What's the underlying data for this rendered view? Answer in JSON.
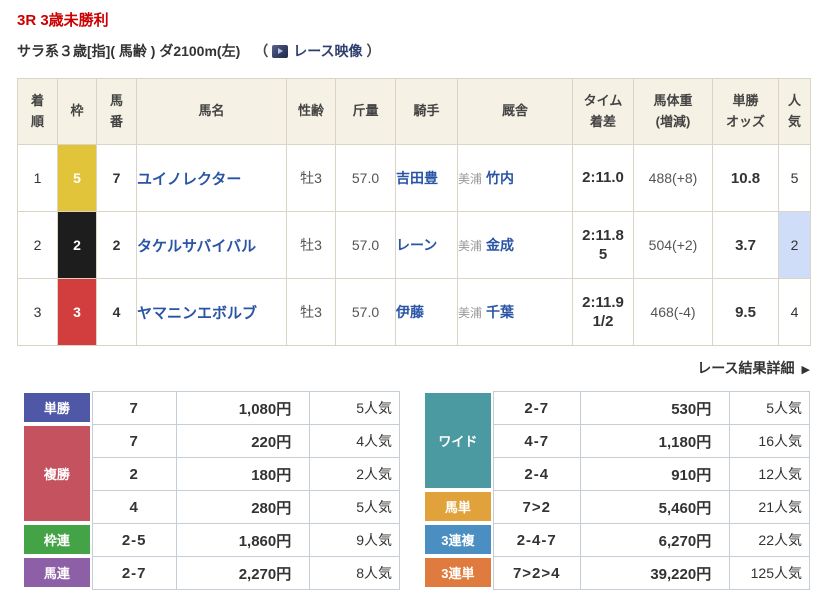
{
  "page": {
    "title": "3R 3歳未勝利",
    "subtitle": "サラ系３歳[指]( 馬齢 ) ダ2100m(左)",
    "paren_open": "（",
    "paren_close": "）",
    "video_link_label": "レース映像",
    "detail_link_label": "レース結果詳細",
    "detail_arrow": "▶"
  },
  "colors": {
    "title_red": "#cc0000",
    "link_blue": "#2a55a5",
    "header_bg": "#f5f1e4",
    "pop_highlight": "#cfddf8"
  },
  "results": {
    "headers": [
      "着\n順",
      "枠",
      "馬\n番",
      "馬名",
      "性齢",
      "斤量",
      "騎手",
      "厩舎",
      "タイム\n着差",
      "馬体重\n(増減)",
      "単勝\nオッズ",
      "人\n気"
    ],
    "rows": [
      {
        "pos": "1",
        "frame": "5",
        "frame_color": "#e2c43a",
        "num": "7",
        "name": "ユイノレクター",
        "sexage": "牡3",
        "weight": "57.0",
        "jockey": "吉田豊",
        "stable_area": "美浦",
        "trainer": "竹内",
        "time": "2:11.0",
        "margin": "",
        "body_weight": "488(+8)",
        "odds": "10.8",
        "pop": "5",
        "pop_bg": ""
      },
      {
        "pos": "2",
        "frame": "2",
        "frame_color": "#1d1d1d",
        "num": "2",
        "name": "タケルサバイバル",
        "sexage": "牡3",
        "weight": "57.0",
        "jockey": "レーン",
        "stable_area": "美浦",
        "trainer": "金成",
        "time": "2:11.8",
        "margin": "5",
        "body_weight": "504(+2)",
        "odds": "3.7",
        "pop": "2",
        "pop_bg": "#cfddf8"
      },
      {
        "pos": "3",
        "frame": "3",
        "frame_color": "#d23d3d",
        "num": "4",
        "name": "ヤマニンエボルブ",
        "sexage": "牡3",
        "weight": "57.0",
        "jockey": "伊藤",
        "stable_area": "美浦",
        "trainer": "千葉",
        "time": "2:11.9",
        "margin": "1/2",
        "body_weight": "468(-4)",
        "odds": "9.5",
        "pop": "4",
        "pop_bg": ""
      }
    ]
  },
  "payouts": {
    "left": [
      {
        "label": "単勝",
        "color": "#4f57a7",
        "rows": [
          {
            "combo": "7",
            "amount": "1,080円",
            "pop": "5人気"
          }
        ]
      },
      {
        "label": "複勝",
        "color": "#c5525f",
        "rows": [
          {
            "combo": "7",
            "amount": "220円",
            "pop": "4人気"
          },
          {
            "combo": "2",
            "amount": "180円",
            "pop": "2人気"
          },
          {
            "combo": "4",
            "amount": "280円",
            "pop": "5人気"
          }
        ]
      },
      {
        "label": "枠連",
        "color": "#43a346",
        "rows": [
          {
            "combo": "2-5",
            "amount": "1,860円",
            "pop": "9人気"
          }
        ]
      },
      {
        "label": "馬連",
        "color": "#8c5fa7",
        "rows": [
          {
            "combo": "2-7",
            "amount": "2,270円",
            "pop": "8人気"
          }
        ]
      }
    ],
    "right": [
      {
        "label": "ワイド",
        "color": "#4b9aa1",
        "rows": [
          {
            "combo": "2-7",
            "amount": "530円",
            "pop": "5人気"
          },
          {
            "combo": "4-7",
            "amount": "1,180円",
            "pop": "16人気"
          },
          {
            "combo": "2-4",
            "amount": "910円",
            "pop": "12人気"
          }
        ]
      },
      {
        "label": "馬単",
        "color": "#e2a23b",
        "rows": [
          {
            "combo": "7>2",
            "amount": "5,460円",
            "pop": "21人気"
          }
        ]
      },
      {
        "label": "3連複",
        "color": "#4b8ec1",
        "rows": [
          {
            "combo": "2-4-7",
            "amount": "6,270円",
            "pop": "22人気"
          }
        ]
      },
      {
        "label": "3連単",
        "color": "#e07b3f",
        "rows": [
          {
            "combo": "7>2>4",
            "amount": "39,220円",
            "pop": "125人気"
          }
        ]
      }
    ]
  }
}
